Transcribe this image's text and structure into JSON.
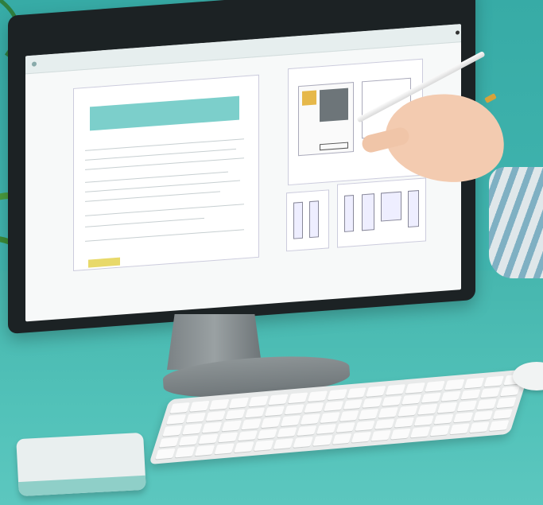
{
  "colors": {
    "wall": "#3fb3ad",
    "desk": "#52c2b9",
    "monitor_bezel": "#1c2224",
    "screen": "#f7f9f9",
    "banner": "#7ccfcb",
    "highlight": "#e8d96a"
  },
  "icons": [
    "plant-icon",
    "toolbar-icon",
    "pencil-icon"
  ]
}
